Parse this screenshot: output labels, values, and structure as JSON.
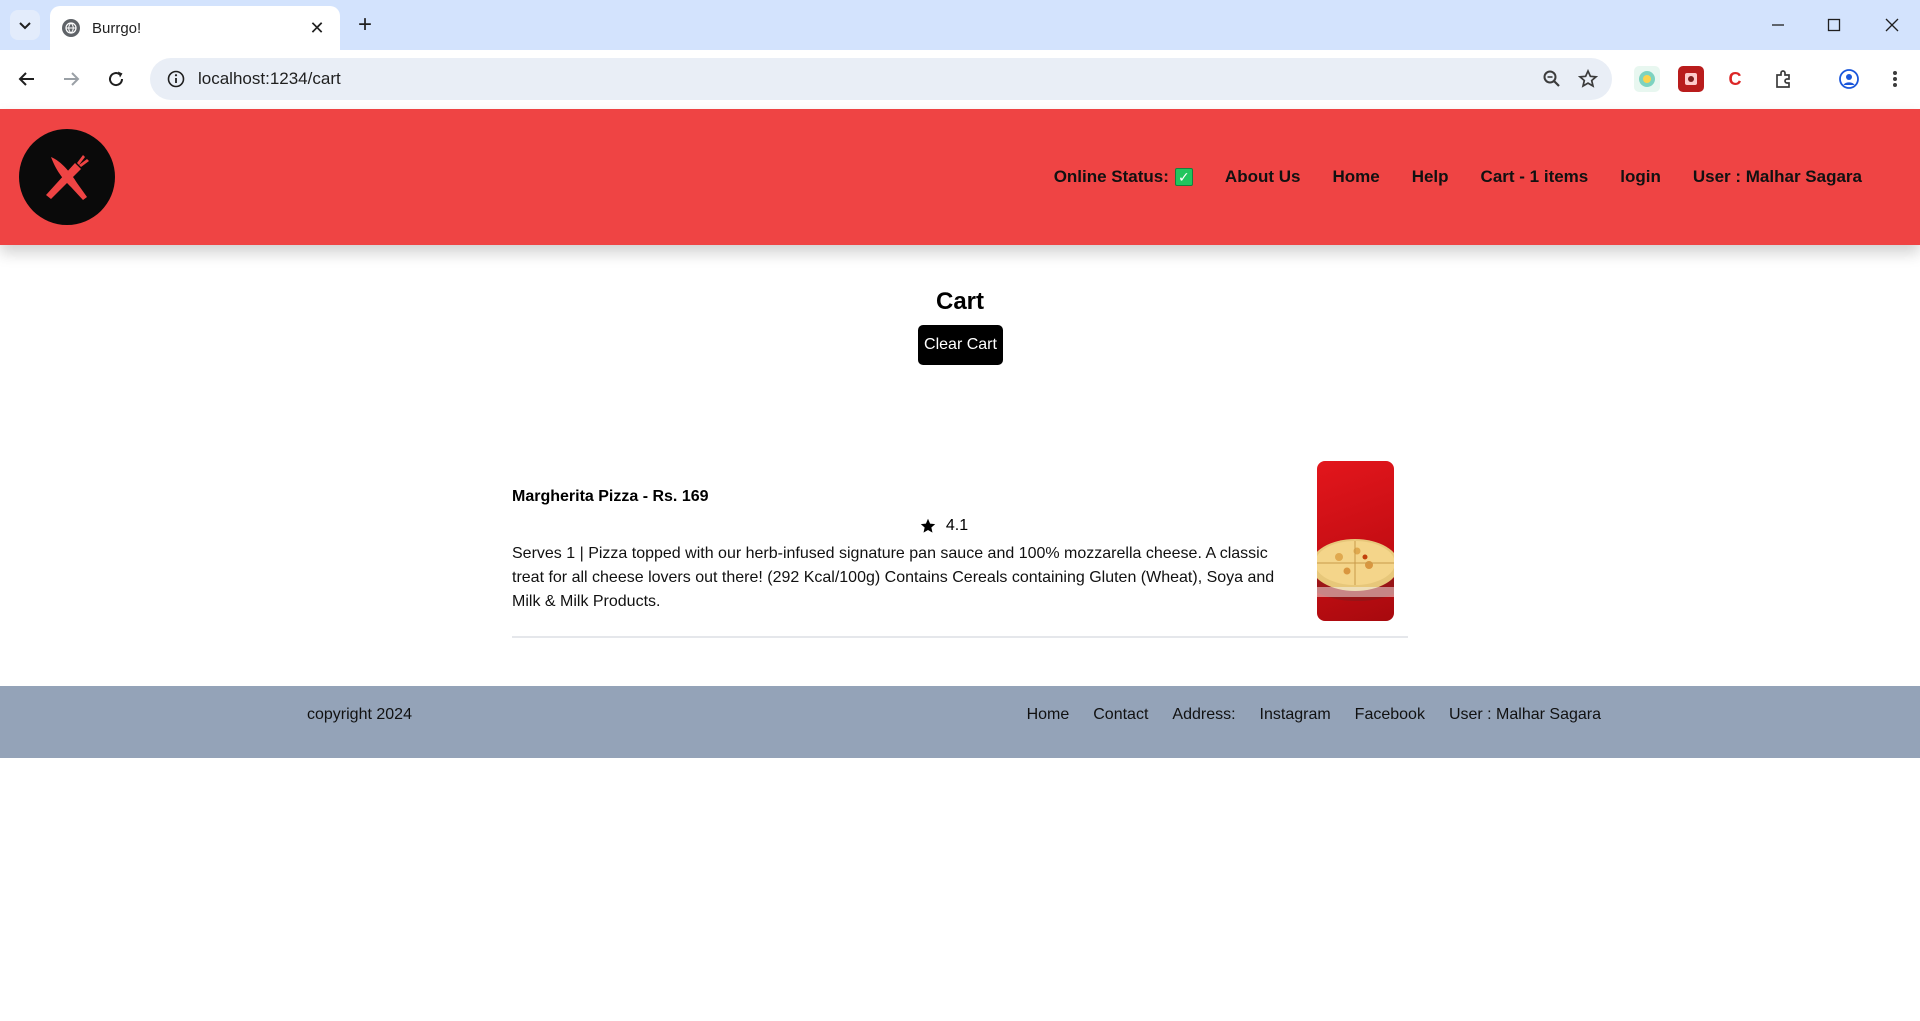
{
  "browser": {
    "tab_title": "Burrgo!",
    "url": "localhost:1234/cart",
    "new_tab_symbol": "+",
    "close_symbol": "✕"
  },
  "header": {
    "online_status_label": "Online Status:",
    "online_status_icon": "white-check-mark-icon",
    "nav": [
      "About Us",
      "Home",
      "Help",
      "Cart - 1 items",
      "login",
      "User : Malhar Sagara"
    ]
  },
  "main": {
    "title": "Cart",
    "clear_button": "Clear Cart",
    "items": [
      {
        "name": "Margherita Pizza - Rs. 169",
        "rating": "4.1",
        "description": "Serves 1 | Pizza topped with our herb-infused signature pan sauce and 100% mozzarella cheese. A classic treat for all cheese lovers out there! (292 Kcal/100g) Contains Cereals containing Gluten (Wheat), Soya and Milk & Milk Products."
      }
    ]
  },
  "footer": {
    "copyright": "copyright 2024",
    "links": [
      "Home",
      "Contact",
      "Address:",
      "Instagram",
      "Facebook",
      "User : Malhar Sagara"
    ]
  },
  "colors": {
    "header_bg": "#ef4444",
    "footer_bg": "#94a3b8",
    "button_bg": "#000000",
    "browser_tabbar": "#d3e3fd"
  }
}
